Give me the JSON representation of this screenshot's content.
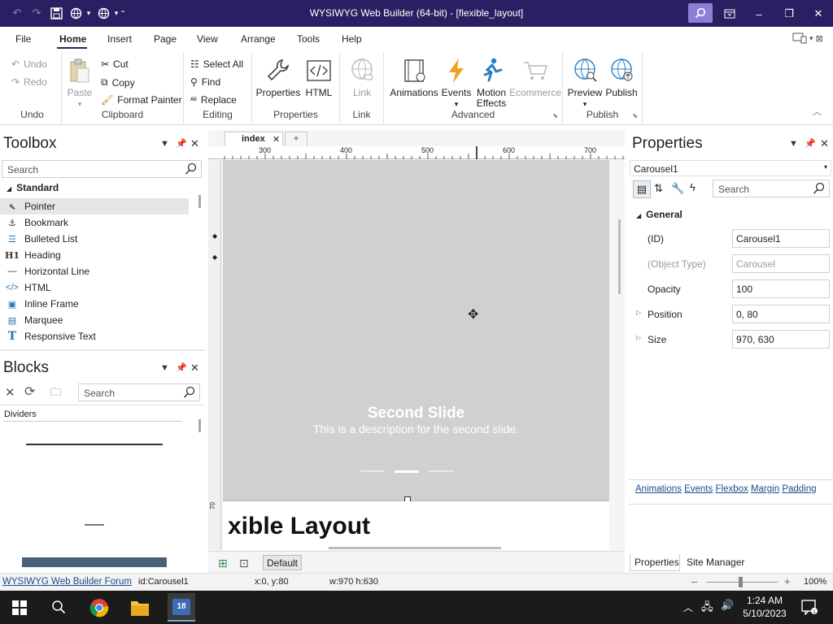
{
  "window": {
    "title": "WYSIWYG Web Builder (64-bit) - [flexible_layout]"
  },
  "menus": [
    "File",
    "Home",
    "Insert",
    "Page",
    "View",
    "Arrange",
    "Tools",
    "Help"
  ],
  "ribbon": {
    "undo": {
      "undo": "Undo",
      "redo": "Redo",
      "group": "Undo"
    },
    "clipboard": {
      "paste": "Paste",
      "cut": "Cut",
      "copy": "Copy",
      "format_painter": "Format Painter",
      "group": "Clipboard"
    },
    "editing": {
      "select_all": "Select All",
      "find": "Find",
      "replace": "Replace",
      "group": "Editing"
    },
    "properties": {
      "properties": "Properties",
      "html": "HTML",
      "group": "Properties"
    },
    "link": {
      "link": "Link",
      "group": "Link"
    },
    "advanced": {
      "animations": "Animations",
      "events": "Events",
      "motion1": "Motion",
      "motion2": "Effects",
      "ecommerce": "Ecommerce",
      "group": "Advanced"
    },
    "publish": {
      "preview": "Preview",
      "publish": "Publish",
      "group": "Publish"
    }
  },
  "toolbox": {
    "title": "Toolbox",
    "search_placeholder": "Search",
    "category": "Standard",
    "items": [
      {
        "label": "Pointer",
        "icon": "pointer-icon"
      },
      {
        "label": "Bookmark",
        "icon": "anchor-icon"
      },
      {
        "label": "Bulleted List",
        "icon": "list-icon"
      },
      {
        "label": "Heading",
        "icon": "heading-icon"
      },
      {
        "label": "Horizontal Line",
        "icon": "line-icon"
      },
      {
        "label": "HTML",
        "icon": "code-icon"
      },
      {
        "label": "Inline Frame",
        "icon": "frame-icon"
      },
      {
        "label": "Marquee",
        "icon": "marquee-icon"
      },
      {
        "label": "Responsive Text",
        "icon": "text-icon"
      }
    ]
  },
  "blocks": {
    "title": "Blocks",
    "search_placeholder": "Search",
    "section": "Dividers"
  },
  "canvas": {
    "tab": "index",
    "ruler": [
      "300",
      "400",
      "500",
      "600",
      "700"
    ],
    "slide_title": "Second Slide",
    "slide_desc": "This is a description for the second slide.",
    "heading_fragment": "xible Layout",
    "ruler_v": "70",
    "breakpoint": "Default"
  },
  "properties": {
    "title": "Properties",
    "selected": "Carousel1",
    "search_placeholder": "Search",
    "section": "General",
    "rows": [
      {
        "label": "(ID)",
        "value": "Carousel1",
        "disabled": false
      },
      {
        "label": "(Object Type)",
        "value": "Carousel",
        "disabled": true
      },
      {
        "label": "Opacity",
        "value": "100",
        "disabled": false
      },
      {
        "label": "Position",
        "value": "0, 80",
        "disabled": false
      },
      {
        "label": "Size",
        "value": "970, 630",
        "disabled": false
      }
    ],
    "links": [
      "Animations",
      "Events",
      "Flexbox",
      "Margin",
      "Padding"
    ],
    "tabs": [
      "Properties",
      "Site Manager"
    ]
  },
  "status": {
    "link": "WYSIWYG Web Builder Forum",
    "id": "id:Carousel1",
    "pos": "x:0, y:80",
    "size": "w:970 h:630",
    "zoom": "100%"
  },
  "taskbar": {
    "time": "1:24 AM",
    "date": "5/10/2023",
    "badge": "18"
  },
  "colors": {
    "titlebar": "#2b1f63",
    "slide": "#d0d0d0",
    "accent": "#1a4b8c"
  }
}
